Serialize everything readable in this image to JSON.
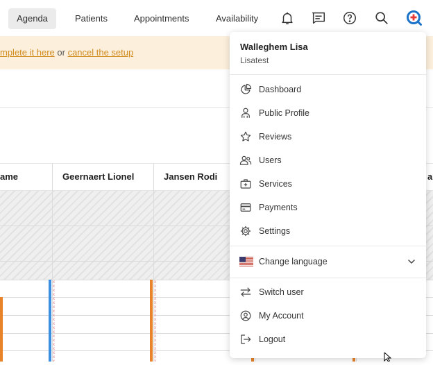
{
  "nav": {
    "tabs": [
      {
        "label": "Agenda",
        "active": true
      },
      {
        "label": "Patients"
      },
      {
        "label": "Appointments"
      },
      {
        "label": "Availability"
      }
    ],
    "icons": [
      "bell-icon",
      "message-icon",
      "help-icon",
      "search-icon",
      "profile-avatar-icon"
    ]
  },
  "banner": {
    "link1": "mplete it here",
    "middle": " or ",
    "link2": "cancel the setup"
  },
  "grid": {
    "columns": [
      "ame",
      "Geernaert Lionel",
      "Jansen Rodi",
      "a"
    ]
  },
  "dropdown": {
    "user_name": "Walleghem Lisa",
    "user_sub": "Lisatest",
    "items": [
      {
        "label": "Dashboard",
        "icon": "pie-chart-icon"
      },
      {
        "label": "Public Profile",
        "icon": "person-icon"
      },
      {
        "label": "Reviews",
        "icon": "star-icon"
      },
      {
        "label": "Users",
        "icon": "users-icon"
      },
      {
        "label": "Services",
        "icon": "medical-kit-icon"
      },
      {
        "label": "Payments",
        "icon": "credit-card-icon"
      },
      {
        "label": "Settings",
        "icon": "gear-icon"
      }
    ],
    "language": {
      "label": "Change language",
      "icon": "us-flag-icon"
    },
    "bottom_items": [
      {
        "label": "Switch user",
        "icon": "switch-arrows-icon"
      },
      {
        "label": "My Account",
        "icon": "account-circle-icon"
      },
      {
        "label": "Logout",
        "icon": "logout-icon"
      }
    ]
  },
  "colors": {
    "accent": "#d08a1f",
    "banner_bg": "#fcf0dc",
    "brand": "#1a73c9",
    "brand_cross": "#e53935",
    "bar_orange": "#e8832a",
    "bar_blue": "#3b8ee0"
  }
}
